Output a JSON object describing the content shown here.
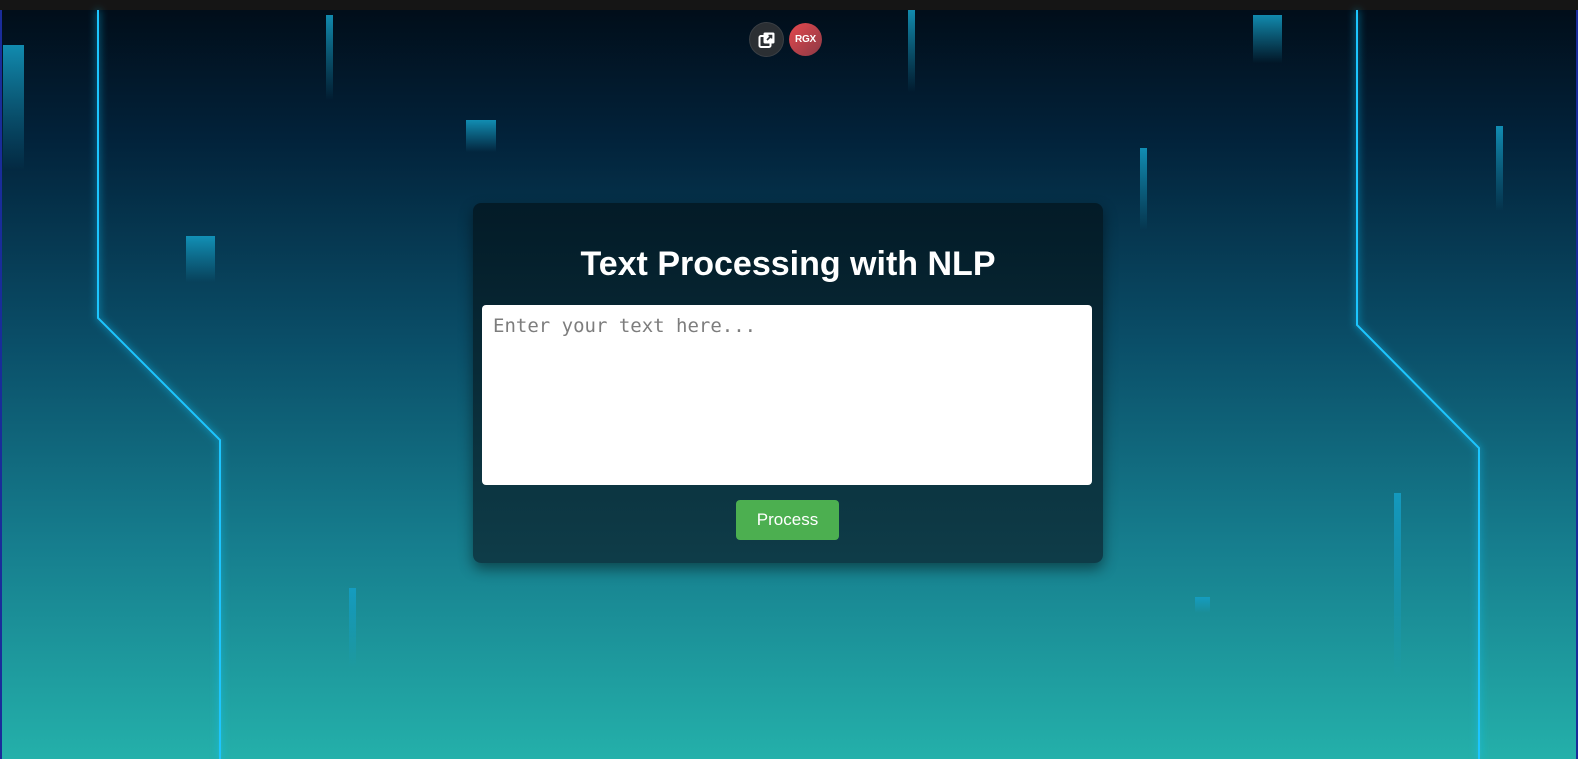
{
  "toolbar": {
    "extension_icon": "external-window-icon",
    "rgx_label": "RGX"
  },
  "card": {
    "title": "Text Processing with NLP",
    "input_placeholder": "Enter your text here...",
    "input_value": "",
    "process_label": "Process"
  },
  "colors": {
    "accent_green": "#4caf50",
    "neon_cyan": "#1fc6ff",
    "background_top": "#010c17",
    "background_bottom": "#24b0aa"
  }
}
